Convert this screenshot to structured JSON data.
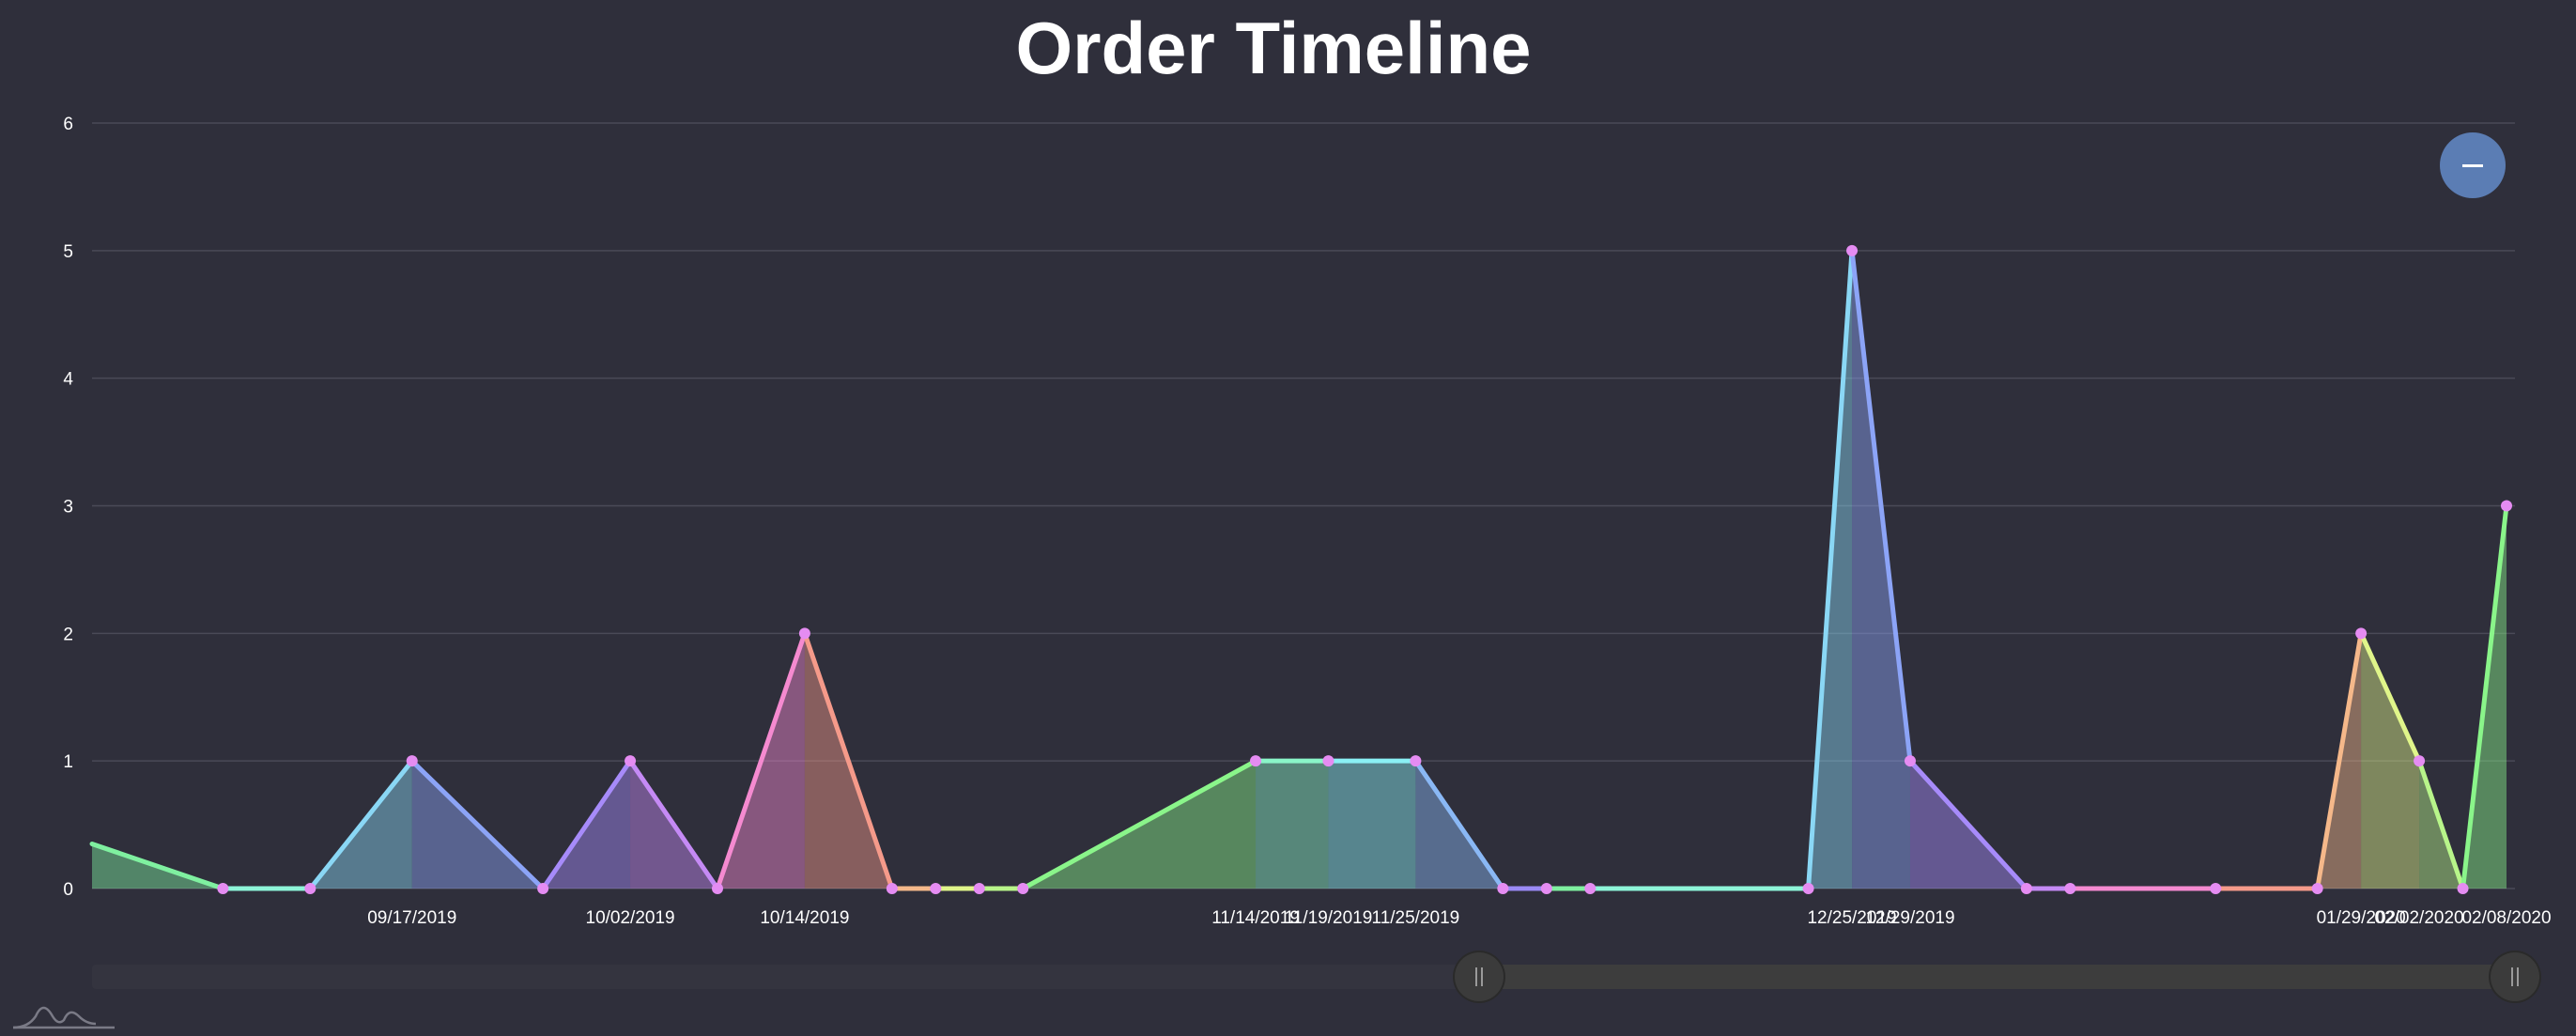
{
  "chart_data": {
    "type": "area",
    "title": "Order Timeline",
    "xlabel": "",
    "ylabel": "",
    "ylim": [
      0,
      6
    ],
    "y_ticks": [
      0,
      1,
      2,
      3,
      4,
      5,
      6
    ],
    "grid": true,
    "x_date_range": [
      "2019-08-26",
      "2020-02-08"
    ],
    "points": [
      {
        "date": "2019-09-04",
        "value": 0
      },
      {
        "date": "2019-09-10",
        "value": 0
      },
      {
        "date": "2019-09-17",
        "value": 1
      },
      {
        "date": "2019-09-26",
        "value": 0
      },
      {
        "date": "2019-10-02",
        "value": 1
      },
      {
        "date": "2019-10-08",
        "value": 0
      },
      {
        "date": "2019-10-14",
        "value": 2
      },
      {
        "date": "2019-10-20",
        "value": 0
      },
      {
        "date": "2019-10-23",
        "value": 0
      },
      {
        "date": "2019-10-26",
        "value": 0
      },
      {
        "date": "2019-10-29",
        "value": 0
      },
      {
        "date": "2019-11-14",
        "value": 1
      },
      {
        "date": "2019-11-19",
        "value": 1
      },
      {
        "date": "2019-11-25",
        "value": 1
      },
      {
        "date": "2019-12-01",
        "value": 0
      },
      {
        "date": "2019-12-04",
        "value": 0
      },
      {
        "date": "2019-12-07",
        "value": 0
      },
      {
        "date": "2019-12-22",
        "value": 0
      },
      {
        "date": "2019-12-25",
        "value": 5
      },
      {
        "date": "2019-12-29",
        "value": 1
      },
      {
        "date": "2020-01-06",
        "value": 0
      },
      {
        "date": "2020-01-09",
        "value": 0
      },
      {
        "date": "2020-01-19",
        "value": 0
      },
      {
        "date": "2020-01-29",
        "value": 2
      },
      {
        "date": "2020-01-26",
        "value": 0
      },
      {
        "date": "2020-02-02",
        "value": 1
      },
      {
        "date": "2020-02-05",
        "value": 0
      },
      {
        "date": "2020-02-08",
        "value": 3
      }
    ],
    "x_tick_labels": [
      "09/17/2019",
      "10/02/2019",
      "10/14/2019",
      "11/14/2019",
      "11/19/2019",
      "11/25/2019",
      "12/25/2019",
      "12/29/2019",
      "01/29/2020",
      "02/02/2020",
      "02/08/2020"
    ],
    "colors": {
      "background": "#2f2f3b",
      "grid": "#4a4a57",
      "point": "#e58cf2",
      "segment_palette": [
        "#7ff0a0",
        "#8ef5d8",
        "#8ad7f5",
        "#8ca4f7",
        "#a78bfa",
        "#c58af5",
        "#f58ad0",
        "#f59a8a",
        "#f5b88a",
        "#e0f58a",
        "#b8f58a",
        "#8af58a",
        "#8af5c8",
        "#8af0f5",
        "#8ab8f5",
        "#9a8af5"
      ]
    }
  },
  "controls": {
    "zoom_out_icon": "minus-icon",
    "scrollbar_grip_icon": "grip-icon",
    "logo_icon": "amcharts-logo-icon"
  }
}
